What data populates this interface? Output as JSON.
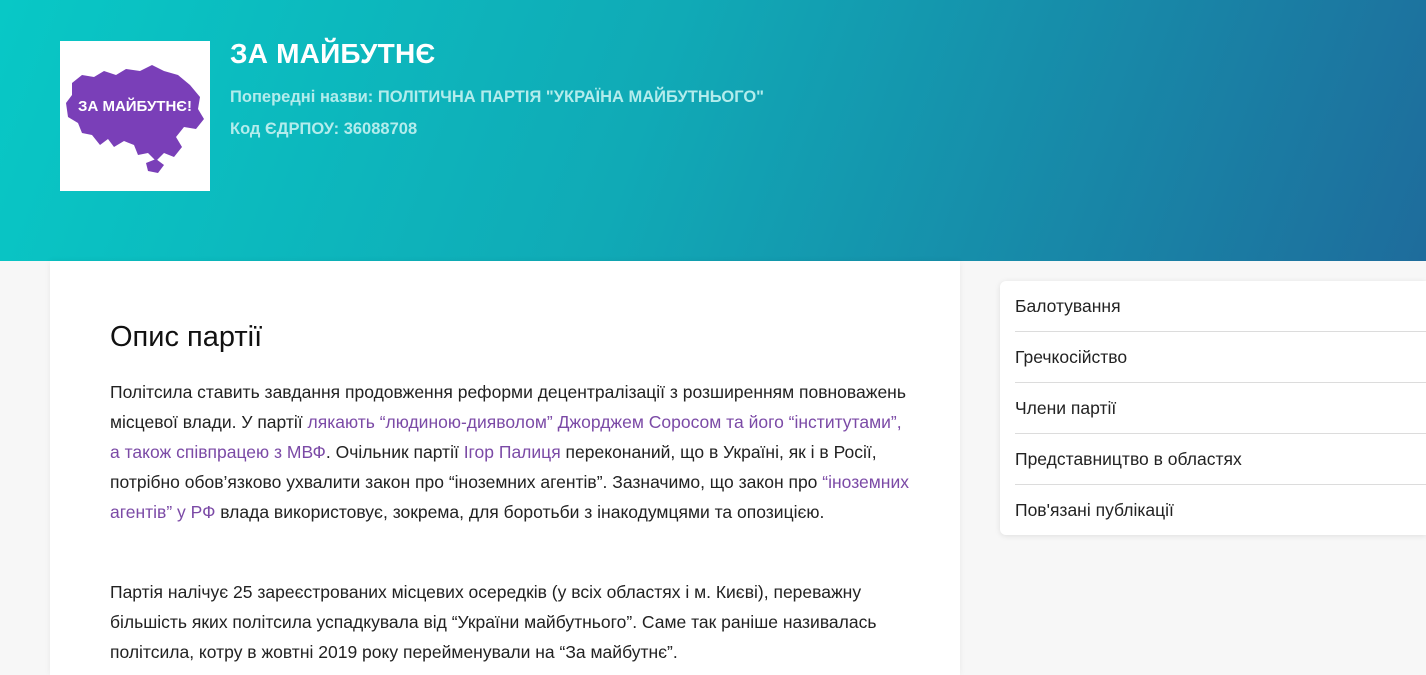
{
  "header": {
    "logo_text": "ЗА МАЙБУТНЄ!",
    "party_name": "ЗА МАЙБУТНЄ",
    "previous_names": "Попередні назви: ПОЛІТИЧНА ПАРТІЯ \"УКРАЇНА МАЙБУТНЬОГО\"",
    "edrpou": "Код ЄДРПОУ: 36088708"
  },
  "main": {
    "title": "Опис партії",
    "p1": {
      "t1": "Політсила ставить завдання продовження реформи децентралізації з розширенням повноважень місцевої влади. У партії ",
      "link1": "лякають “людиною-дияволом” Джорджем Соросом та його “інститутами”, а також співпрацею з МВФ",
      "t2": ". Очільник партії ",
      "link2": "Ігор Палиця",
      "t3": " переконаний, що в Україні, як і в Росії, потрібно обов’язково ухвалити закон про “іноземних агентів”. Зазначимо, що закон про ",
      "link3": "“іноземних агентів” у РФ",
      "t4": " влада використовує, зокрема, для боротьби з інакодумцями та опозицією."
    },
    "p2": "Партія налічує 25 зареєстрованих місцевих осередків (у всіх областях і м. Києві), переважну більшість яких політсила успадкувала від “України майбутнього”. Саме так раніше називалась політсила, котру в жовтні 2019 року перейменували на “За майбутнє”."
  },
  "sidebar": {
    "items": [
      {
        "label": "Балотування"
      },
      {
        "label": "Гречкосійство"
      },
      {
        "label": "Члени партії"
      },
      {
        "label": "Представництво в областях"
      },
      {
        "label": "Пов'язані публікації"
      }
    ]
  },
  "colors": {
    "header_gradient_start": "#08c8c6",
    "header_gradient_end": "#1e6c9c",
    "link": "#7b4aa6",
    "logo_map": "#7a3fb8"
  },
  "icons": {
    "logo": "party-logo-map-of-ukraine"
  }
}
